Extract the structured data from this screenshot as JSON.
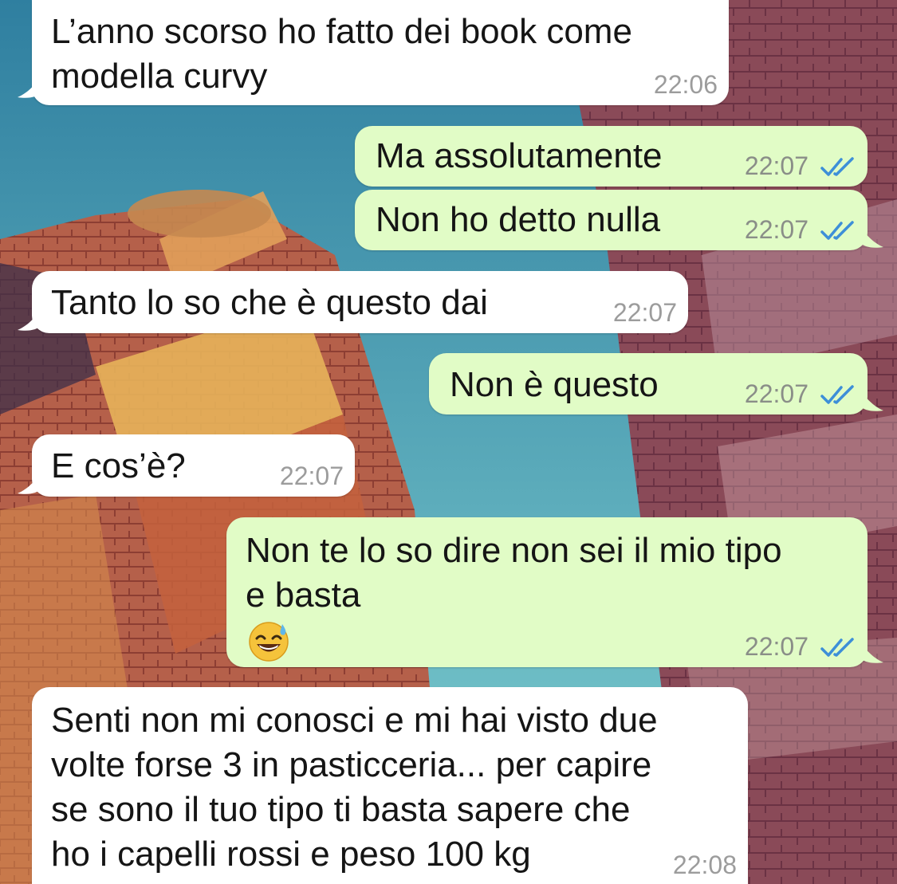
{
  "conversation": {
    "messages": [
      {
        "direction": "incoming",
        "text": "L’anno scorso ho fatto dei book come\nmodella curvy",
        "time": "22:06"
      },
      {
        "direction": "outgoing",
        "text": "Ma assolutamente",
        "time": "22:07",
        "status": "read"
      },
      {
        "direction": "outgoing",
        "text": "Non ho detto nulla",
        "time": "22:07",
        "status": "read"
      },
      {
        "direction": "incoming",
        "text": "Tanto lo so che è questo dai",
        "time": "22:07"
      },
      {
        "direction": "outgoing",
        "text": "Non è questo",
        "time": "22:07",
        "status": "read"
      },
      {
        "direction": "incoming",
        "text": "E cos’è?",
        "time": "22:07"
      },
      {
        "direction": "outgoing",
        "text": "Non te lo so dire non sei il mio tipo\ne basta",
        "emoji": "grinning-sweat-emoji",
        "time": "22:07",
        "status": "read"
      },
      {
        "direction": "incoming",
        "text": "Senti non mi conosci e mi hai visto due\nvolte forse 3 in pasticceria... per capire\nse sono il tuo tipo ti basta sapere che\nho i capelli rossi e peso 100 kg",
        "time": "22:08"
      }
    ]
  },
  "colors": {
    "incoming_bubble": "#ffffff",
    "outgoing_bubble": "#e1fcc6",
    "read_ticks": "#3d8fd8"
  },
  "icons": {
    "read_receipt": "double-check-icon",
    "wallpaper": "building-photo-wallpaper"
  }
}
